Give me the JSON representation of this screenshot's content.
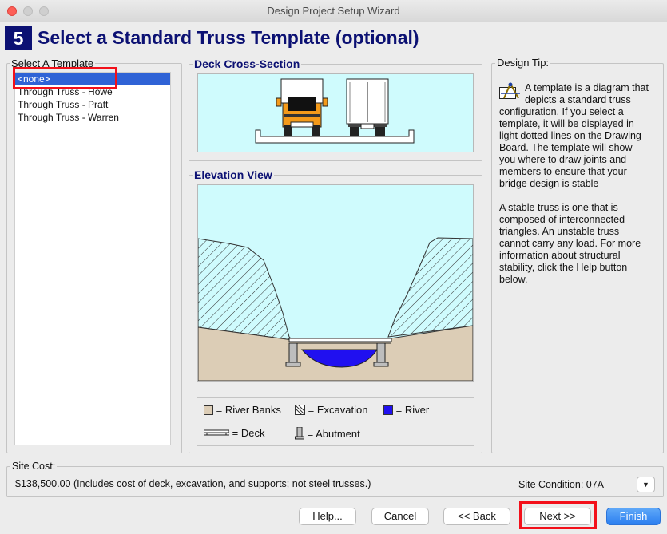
{
  "window": {
    "title": "Design Project Setup Wizard"
  },
  "step": {
    "number": "5",
    "title": "Select a Standard Truss Template (optional)"
  },
  "templates": {
    "label": "Select A Template",
    "items": [
      "<none>",
      "Through Truss - Howe",
      "Through Truss - Pratt",
      "Through Truss - Warren"
    ],
    "selected_index": 0
  },
  "deck": {
    "label": "Deck Cross-Section"
  },
  "elevation": {
    "label": "Elevation View"
  },
  "legend": {
    "river_banks": "= River Banks",
    "excavation": "= Excavation",
    "river": "= River",
    "deck": "= Deck",
    "abutment": "= Abutment"
  },
  "tip": {
    "label": "Design Tip:",
    "p1": "A template is a diagram that depicts a standard truss configuration. If you select a template, it will be displayed in light dotted lines on the Drawing Board. The template will show you where to draw joints and members to ensure that your bridge design is stable",
    "p2": "A stable truss is one that is composed of interconnected triangles. An unstable truss cannot carry any load. For more information about structural stability, click the Help button below."
  },
  "site": {
    "label": "Site Cost:",
    "cost": "$138,500.00  (Includes cost of deck, excavation, and supports; not steel trusses.)",
    "condition": "Site Condition: 07A"
  },
  "buttons": {
    "help": "Help...",
    "cancel": "Cancel",
    "back": "<< Back",
    "next": "Next >>",
    "finish": "Finish"
  },
  "colors": {
    "accent": "#0c1173",
    "selection": "#2f63d6",
    "highlight": "#f3101a",
    "sky": "#cffbfd",
    "river": "#2010f0",
    "banks": "#dccdb6",
    "truck": "#f49a1a"
  }
}
